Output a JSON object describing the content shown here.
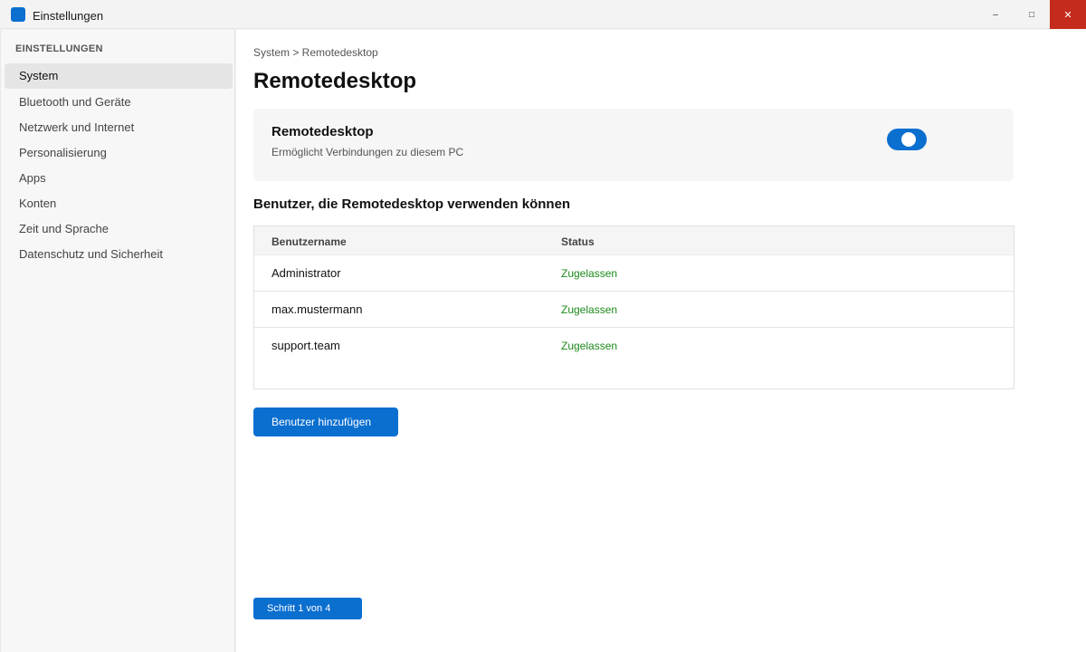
{
  "window": {
    "title": "Einstellungen",
    "minimize_glyph": "–",
    "maximize_glyph": "□",
    "close_glyph": "✕"
  },
  "sidebar": {
    "heading": "EINSTELLUNGEN",
    "items": [
      {
        "label": "System",
        "active": true
      },
      {
        "label": "Bluetooth und Geräte"
      },
      {
        "label": "Netzwerk und Internet"
      },
      {
        "label": "Personalisierung"
      },
      {
        "label": "Apps"
      },
      {
        "label": "Konten"
      },
      {
        "label": "Zeit und Sprache"
      },
      {
        "label": "Datenschutz und Sicherheit"
      }
    ]
  },
  "main": {
    "breadcrumb": "System > Remotedesktop",
    "title": "Remotedesktop",
    "card": {
      "title": "Remotedesktop",
      "description": "Ermöglicht Verbindungen zu diesem PC",
      "toggle_on": true
    },
    "users_heading": "Benutzer, die Remotedesktop verwenden können",
    "table": {
      "headers": [
        "Benutzername",
        "Status"
      ],
      "rows": [
        {
          "name": "Administrator",
          "status": "Zugelassen"
        },
        {
          "name": "max.mustermann",
          "status": "Zugelassen"
        },
        {
          "name": "support.team",
          "status": "Zugelassen"
        }
      ]
    },
    "add_user_label": "Benutzer hinzufügen",
    "step_label": "Schritt 1 von 4"
  },
  "colors": {
    "accent": "#0b6fd0",
    "status_ok": "#1c8a1c",
    "close_red": "#c42b1c"
  }
}
